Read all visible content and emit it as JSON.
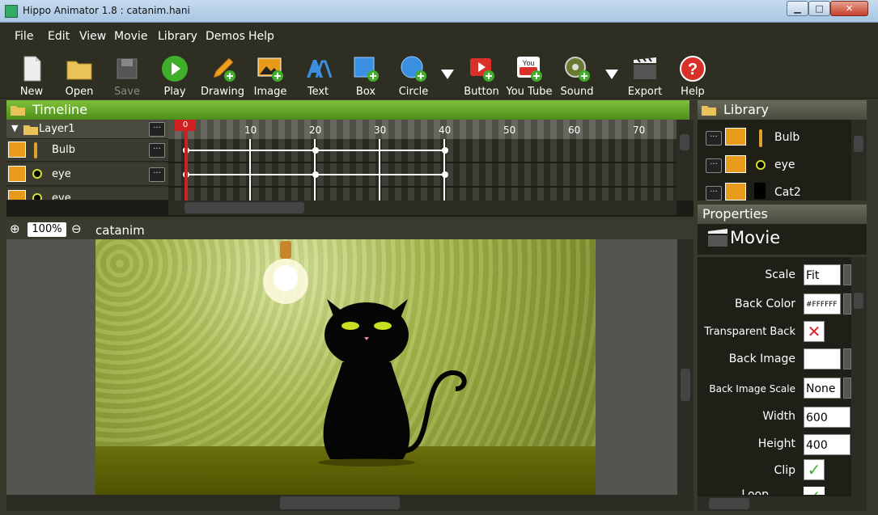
{
  "window": {
    "title": "Hippo Animator 1.8 : catanim.hani",
    "minimize": "▁",
    "maximize": "□",
    "close": "✕"
  },
  "menu": [
    "File",
    "Edit",
    "View",
    "Movie",
    "Library",
    "Demos",
    "Help"
  ],
  "toolbar": {
    "new": "New",
    "open": "Open",
    "save": "Save",
    "play": "Play",
    "drawing": "Drawing",
    "image": "Image",
    "text": "Text",
    "box": "Box",
    "circle": "Circle",
    "button": "Button",
    "youtube": "You Tube",
    "sound": "Sound",
    "export": "Export",
    "help": "Help"
  },
  "timeline": {
    "title": "Timeline",
    "layer": "Layer1",
    "rows": [
      "Bulb",
      "eye",
      "eye"
    ],
    "current_frame": "0",
    "ticks": [
      "10",
      "20",
      "30",
      "40",
      "50",
      "60",
      "70"
    ]
  },
  "stage": {
    "zoom": "100%",
    "name": "catanim"
  },
  "library": {
    "title": "Library",
    "items": [
      "Bulb",
      "eye",
      "Cat2"
    ]
  },
  "properties": {
    "title": "Properties",
    "object": "Movie",
    "scale_label": "Scale",
    "scale_value": "Fit",
    "back_color_label": "Back Color",
    "back_color_value": "#FFFFFF",
    "transparent_label": "Transparent Back",
    "back_image_label": "Back Image",
    "back_image_value": "",
    "back_image_scale_label": "Back Image Scale",
    "back_image_scale_value": "None",
    "width_label": "Width",
    "width_value": "600",
    "height_label": "Height",
    "height_value": "400",
    "clip_label": "Clip",
    "loop_label": "Loop"
  },
  "colors": {
    "accent_green": "#5fa322",
    "dark_bg": "#38382c",
    "keyframe_red": "#d02020"
  }
}
